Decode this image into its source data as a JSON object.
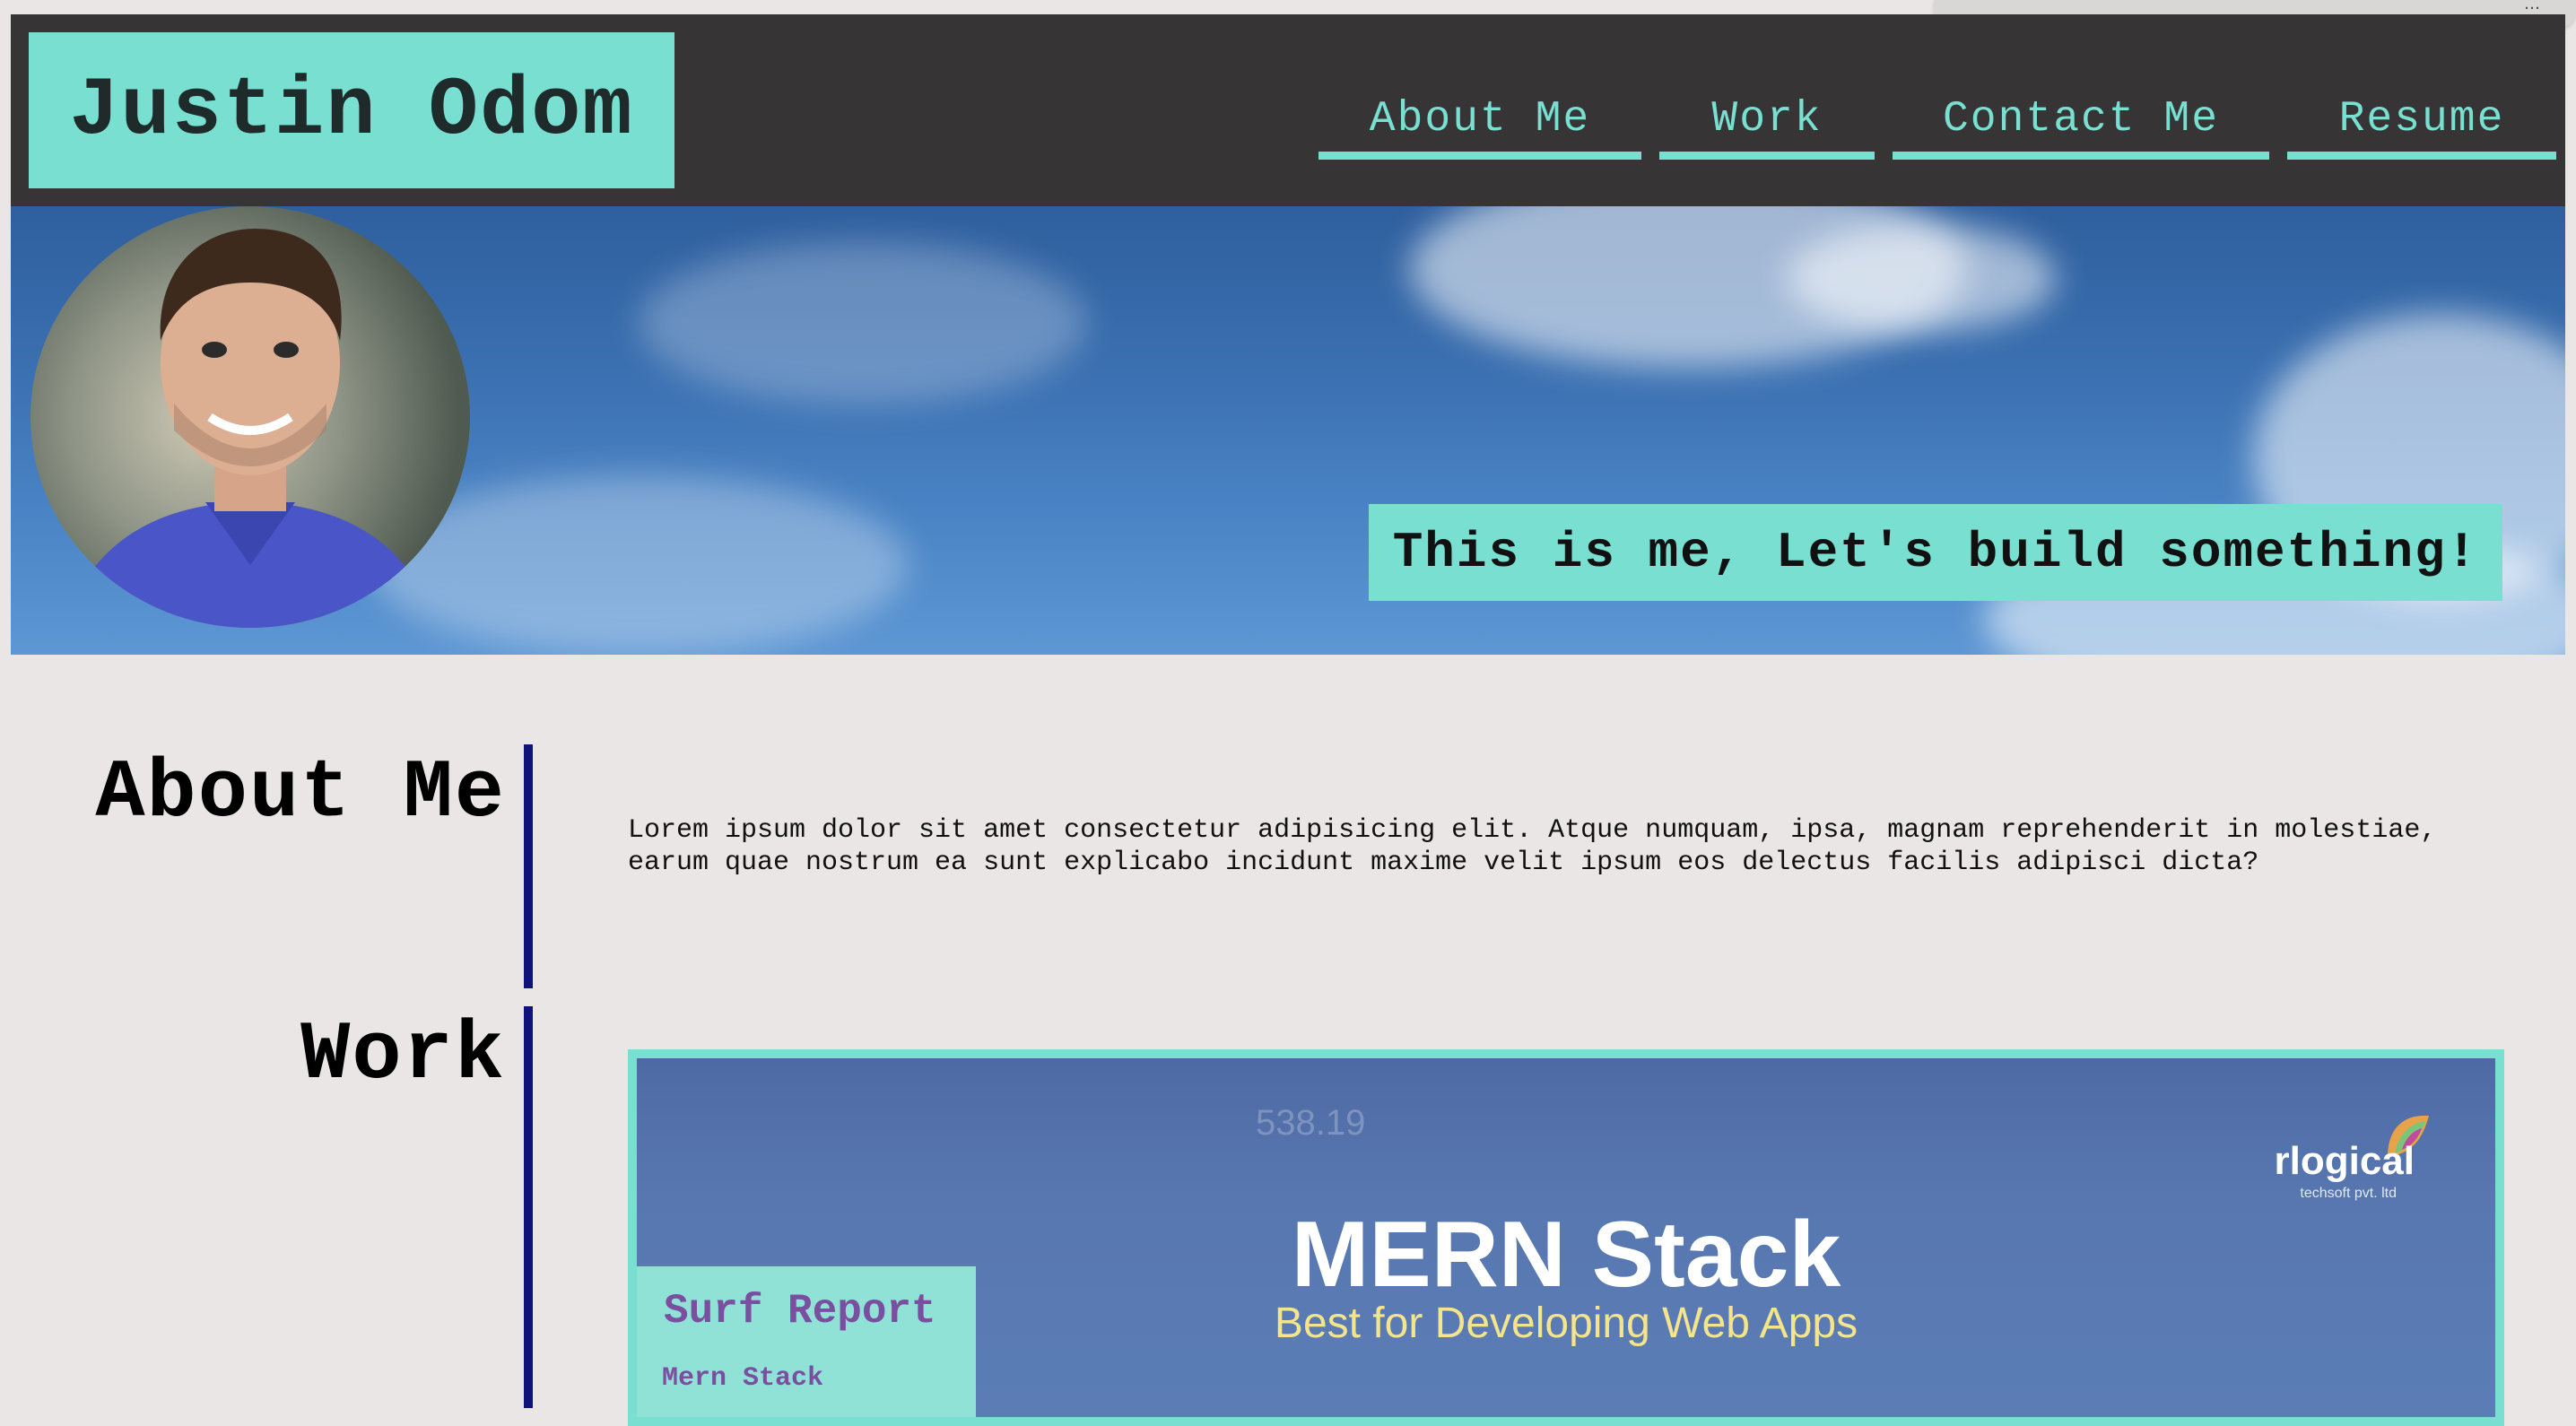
{
  "header": {
    "name": "Justin Odom",
    "nav": [
      {
        "label": "About Me"
      },
      {
        "label": "Work"
      },
      {
        "label": "Contact Me"
      },
      {
        "label": "Resume"
      }
    ]
  },
  "hero": {
    "portrait_alt": "portrait-photo",
    "tagline": "This is me, Let's build something!"
  },
  "about": {
    "title": "About Me",
    "text": "Lorem ipsum dolor sit amet consectetur adipisicing elit. Atque numquam, ipsa, magnam reprehenderit in molestiae, earum quae nostrum ea sunt explicabo incidunt maxime velit ipsum eos delectus facilis adipisci dicta?"
  },
  "work": {
    "title": "Work",
    "projects": [
      {
        "title": "Surf Report",
        "tech": "Mern Stack",
        "image": {
          "headline": "MERN Stack",
          "subheadline": "Best for Developing Web Apps",
          "brand": "rlogical",
          "brand_sub": "techsoft pvt. ltd",
          "ticker": "538.19"
        }
      }
    ]
  },
  "colors": {
    "accent": "#78dfd1",
    "header_bg": "#363435",
    "page_bg": "#ebe6e6",
    "divider": "#10137a",
    "project_label": "#7b4fa0"
  }
}
